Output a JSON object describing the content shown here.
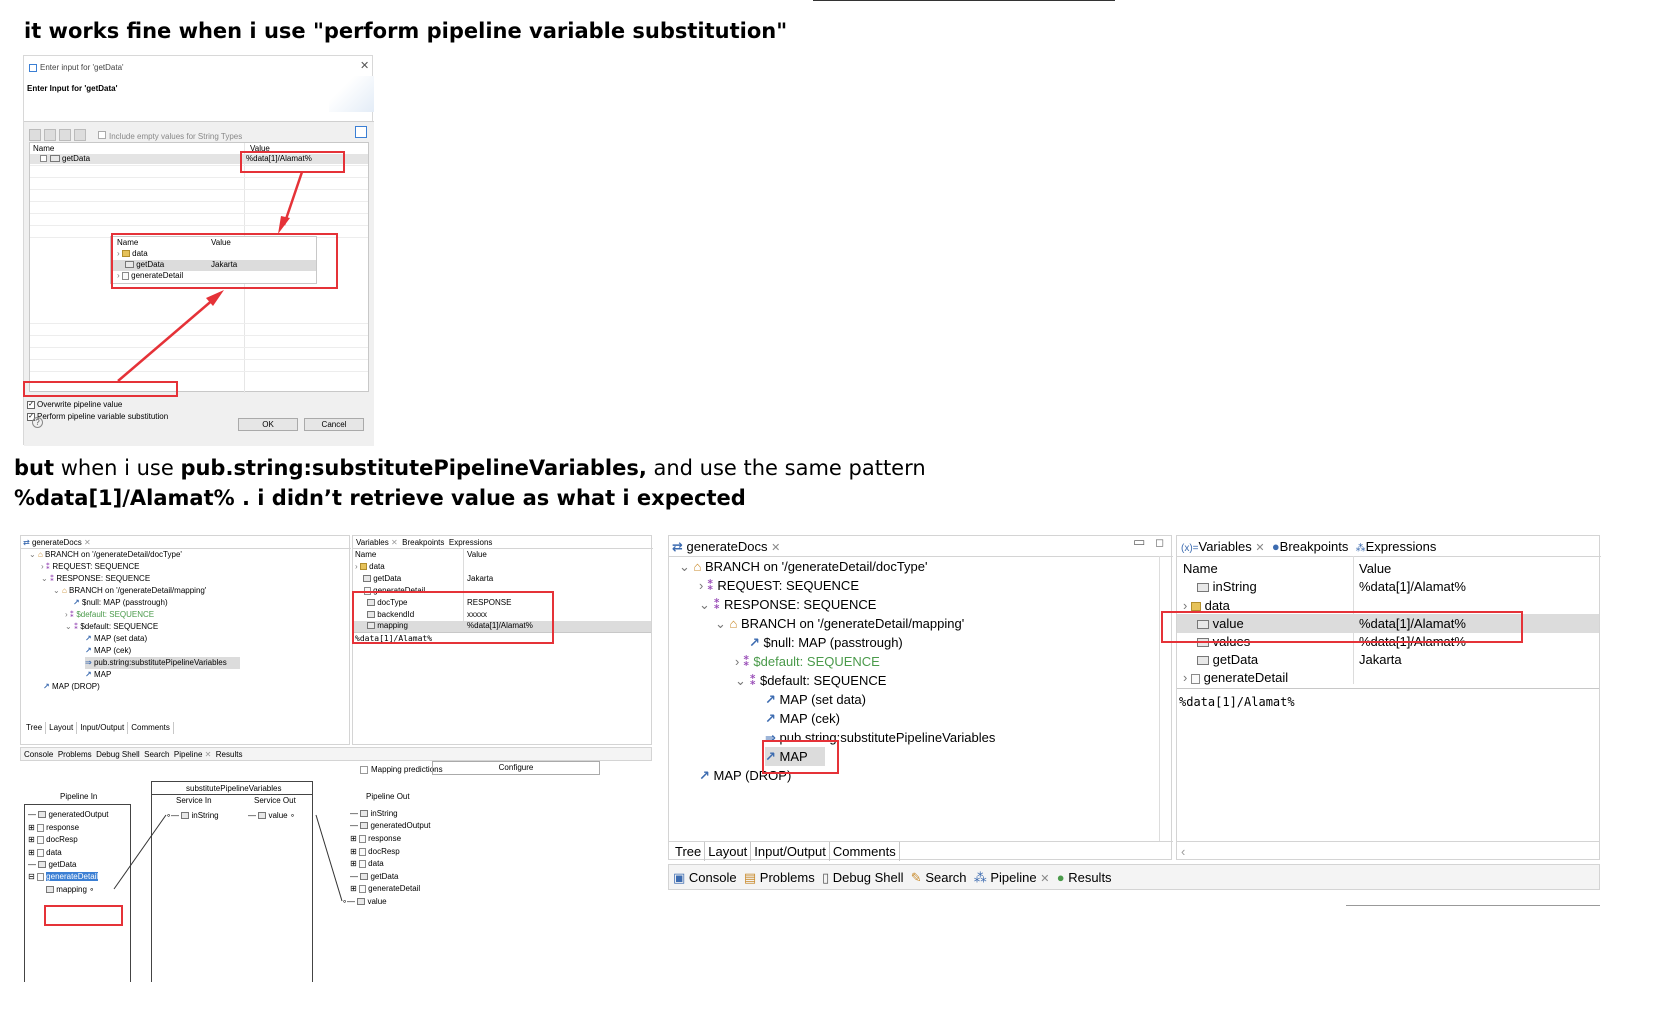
{
  "captions": {
    "line1": "it works fine when i use \"perform pipeline variable substitution\"",
    "line2_a": "but",
    "line2_b": " when i use ",
    "line2_c": "pub.string:substitutePipelineVariables,",
    "line2_d": " and use the same pattern",
    "line3": "%data[1]/Alamat% . i didn’t retrieve value as what i expected"
  },
  "dialog": {
    "window_title": "Enter input for 'getData'",
    "heading": "Enter Input for 'getData'",
    "include_empty_label": "Include empty values for String Types",
    "col_name": "Name",
    "col_value": "Value",
    "row_name": "getData",
    "row_value": "%data[1]/Alamat%",
    "popup": {
      "col_name": "Name",
      "col_value": "Value",
      "rows": [
        {
          "name": "data",
          "value": ""
        },
        {
          "name": "getData",
          "value": "Jakarta"
        },
        {
          "name": "generateDetail",
          "value": ""
        }
      ]
    },
    "overwrite_label": "Overwrite pipeline value",
    "perform_label": "Perform pipeline variable substitution",
    "ok_label": "OK",
    "cancel_label": "Cancel"
  },
  "left_ide": {
    "editor_tab": "generateDocs",
    "tree": [
      "BRANCH on '/generateDetail/docType'",
      "REQUEST: SEQUENCE",
      "RESPONSE: SEQUENCE",
      "BRANCH on '/generateDetail/mapping'",
      "$null: MAP (passtrough)",
      "$default: SEQUENCE",
      "$default: SEQUENCE",
      "MAP (set data)",
      "MAP (cek)",
      "pub.string:substitutePipelineVariables",
      "MAP",
      "MAP (DROP)"
    ],
    "bottom_tabs": [
      "Tree",
      "Layout",
      "Input/Output",
      "Comments"
    ],
    "view_tabs": [
      "Variables",
      "Breakpoints",
      "Expressions"
    ],
    "var_cols": [
      "Name",
      "Value"
    ],
    "vars": [
      {
        "name": "data",
        "value": ""
      },
      {
        "name": "getData",
        "value": "Jakarta"
      },
      {
        "name": "generateDetail",
        "value": ""
      },
      {
        "name": "docType",
        "value": "RESPONSE"
      },
      {
        "name": "backendId",
        "value": "xxxxx"
      },
      {
        "name": "mapping",
        "value": "%data[1]/Alamat%"
      }
    ],
    "detail_text": "%data[1]/Alamat%",
    "console_tabs": [
      "Console",
      "Problems",
      "Debug Shell",
      "Search",
      "Pipeline",
      "Results"
    ],
    "mapping_predictions": "Mapping predictions",
    "configure": "Configure",
    "pipeline_in": "Pipeline In",
    "service_title": "substitutePipelineVariables",
    "service_in": "Service In",
    "service_out": "Service Out",
    "pipeline_out": "Pipeline Out",
    "pin_items": [
      "generatedOutput",
      "response",
      "docResp",
      "data",
      "getData",
      "generateDetail",
      "mapping"
    ],
    "svc_in_item": "inString",
    "svc_out_item": "value",
    "pout_items": [
      "inString",
      "generatedOutput",
      "response",
      "docResp",
      "data",
      "getData",
      "generateDetail",
      "value"
    ]
  },
  "right_ide": {
    "editor_tab": "generateDocs",
    "tree": [
      "BRANCH on '/generateDetail/docType'",
      "REQUEST: SEQUENCE",
      "RESPONSE: SEQUENCE",
      "BRANCH on '/generateDetail/mapping'",
      "$null: MAP (passtrough)",
      "$default: SEQUENCE",
      "$default: SEQUENCE",
      "MAP (set data)",
      "MAP (cek)",
      "pub.string:substitutePipelineVariables",
      "MAP",
      "MAP (DROP)"
    ],
    "bottom_tabs": [
      "Tree",
      "Layout",
      "Input/Output",
      "Comments"
    ],
    "view_tabs": [
      "Variables",
      "Breakpoints",
      "Expressions"
    ],
    "var_cols": [
      "Name",
      "Value"
    ],
    "vars": [
      {
        "name": "inString",
        "value": "%data[1]/Alamat%"
      },
      {
        "name": "data",
        "value": ""
      },
      {
        "name": "value",
        "value": "%data[1]/Alamat%"
      },
      {
        "name": "values",
        "value": "%data[1]/Alamat%"
      },
      {
        "name": "getData",
        "value": "Jakarta"
      },
      {
        "name": "generateDetail",
        "value": ""
      }
    ],
    "detail_text": "%data[1]/Alamat%",
    "console_tabs": [
      "Console",
      "Problems",
      "Debug Shell",
      "Search",
      "Pipeline",
      "Results"
    ]
  },
  "colors": {
    "highlight_red": "#e53238",
    "selection_gray": "#dcdcdc",
    "selection_blue": "#3b7fd4",
    "sequence_purple": "#9a4fb8",
    "default_green": "#4a9a4a"
  }
}
